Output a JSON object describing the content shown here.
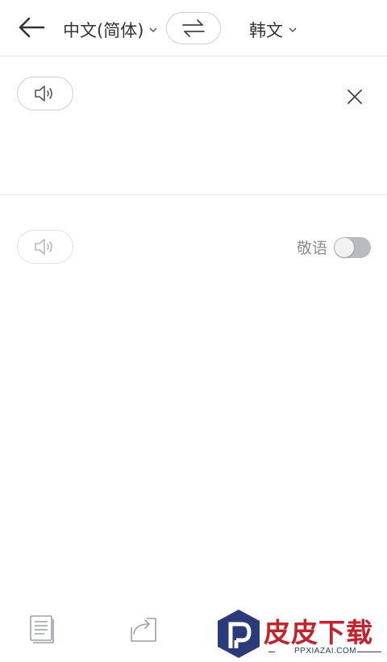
{
  "header": {
    "source_language": "中文(简体)",
    "target_language": "韩文",
    "icons": {
      "back": "arrow-left-icon",
      "swap": "swap-arrows-icon",
      "dropdown": "chevron-down-icon"
    }
  },
  "input": {
    "text": "",
    "icons": {
      "speaker": "speaker-icon",
      "clear": "close-icon"
    }
  },
  "output": {
    "text": "",
    "honorific_label": "敬语",
    "honorific_enabled": false,
    "icons": {
      "speaker": "speaker-icon"
    }
  },
  "toolbar": {
    "icons": {
      "copy": "copy-document-icon",
      "share": "share-icon"
    }
  },
  "watermark": {
    "title": "皮皮下载",
    "subtitle": "PPXIAZAI.COM"
  },
  "colors": {
    "divider": "#e6e6e6",
    "text": "#333333",
    "muted": "#8a8f96",
    "toggle_off": "#b8bcc2",
    "watermark_red": "#c8202a",
    "watermark_blue": "#2a3a7a"
  }
}
